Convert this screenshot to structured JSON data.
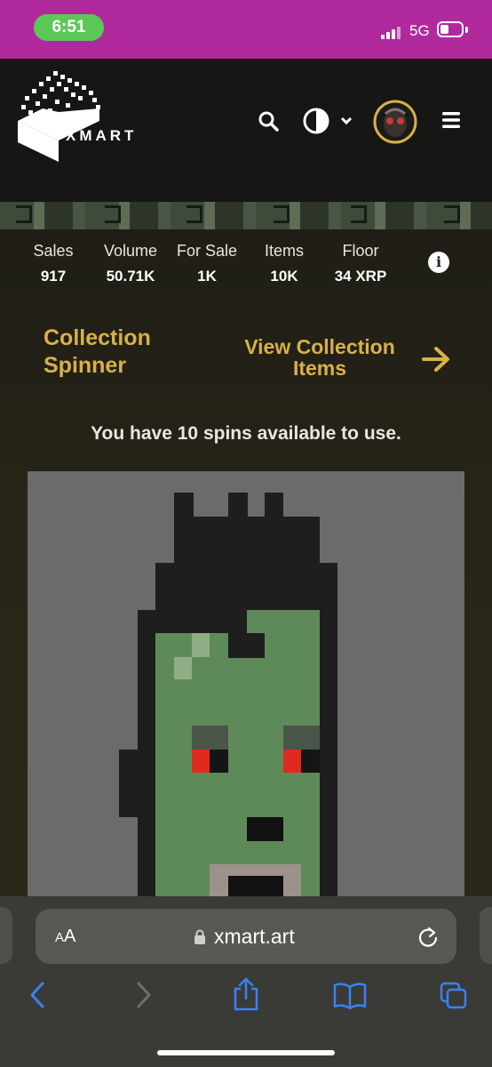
{
  "status_bar": {
    "time": "6:51",
    "network": "5G"
  },
  "header": {
    "logo_text": "XMART",
    "icons": [
      "search-icon",
      "theme-contrast-icon",
      "chevron-down-icon",
      "avatar",
      "menu-icon"
    ]
  },
  "stats": [
    {
      "label": "Sales",
      "value": "917"
    },
    {
      "label": "Volume",
      "value": "50.71K"
    },
    {
      "label": "For Sale",
      "value": "1K"
    },
    {
      "label": "Items",
      "value": "10K"
    },
    {
      "label": "Floor",
      "value": "34 XRP"
    }
  ],
  "spinner": {
    "title_line1": "Collection",
    "title_line2": "Spinner",
    "view_line1": "View Collection",
    "view_line2": "Items",
    "spins_text": "You have 10 spins available to use."
  },
  "browser": {
    "text_size": "AA",
    "url": "xmart.art"
  },
  "colors": {
    "accent_gold": "#d9b04a",
    "status_bar": "#b02a9e",
    "time_pill": "#5bc858",
    "ios_blue": "#3a82f7"
  }
}
